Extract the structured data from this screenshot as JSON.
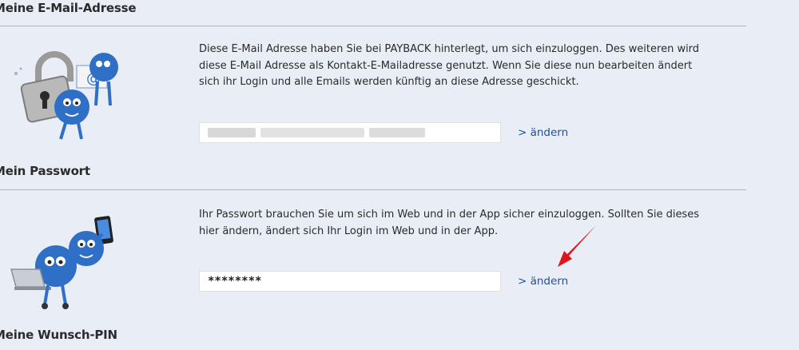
{
  "sections": [
    {
      "heading": "Meine E-Mail-Adresse",
      "description": "Diese E-Mail Adresse haben Sie bei PAYBACK hinterlegt, um sich einzuloggen. Des weiteren wird diese E-Mail Adresse als Kontakt-E-Mailadresse genutzt. Wenn Sie diese nun bearbeiten ändert sich ihr Login und alle Emails werden künftig an diese Adresse geschickt.",
      "field_value": "",
      "link_label": "> ändern"
    },
    {
      "heading": "Mein Passwort",
      "description": "Ihr Passwort brauchen Sie um sich im Web und in der App sicher einzuloggen. Sollten Sie dieses hier ändern, ändert sich Ihr Login im Web und in der App.",
      "field_value": "********",
      "link_label": "> ändern"
    },
    {
      "heading": "Meine Wunsch-PIN"
    }
  ],
  "colors": {
    "background": "#e9eef6",
    "link": "#1f4e9c",
    "arrow": "#e0141b",
    "mascot": "#2f6fc6"
  },
  "icons": {
    "email_illustration": "padlock-mascot-email-icon",
    "password_illustration": "mascots-laptop-phone-icon",
    "annotation": "red-arrow-icon"
  }
}
